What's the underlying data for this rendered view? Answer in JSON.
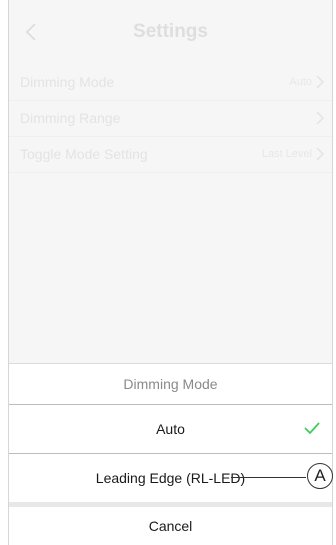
{
  "header": {
    "title": "Settings"
  },
  "settings": [
    {
      "label": "Dimming Mode",
      "value": "Auto"
    },
    {
      "label": "Dimming Range",
      "value": ""
    },
    {
      "label": "Toggle Mode Setting",
      "value": "Last Level"
    }
  ],
  "sheet": {
    "title": "Dimming Mode",
    "options": [
      {
        "label": "Auto",
        "selected": true
      },
      {
        "label": "Leading Edge (RL-LED)",
        "selected": false
      }
    ],
    "cancel_label": "Cancel"
  },
  "callout": {
    "label": "A"
  },
  "colors": {
    "accent": "#3dcd58",
    "dimmed_text": "#dddddd"
  },
  "icons": [
    "chevron-left-icon",
    "chevron-right-icon",
    "checkmark-icon"
  ]
}
